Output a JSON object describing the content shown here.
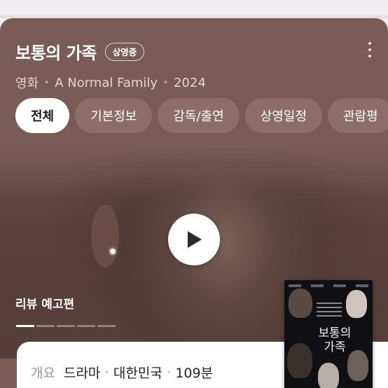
{
  "header": {
    "title": "보통의 가족",
    "status_badge": "상영중",
    "more_icon": "more-vertical-icon",
    "subtitle": {
      "category": "영화",
      "original_title": "A Normal Family",
      "year": "2024"
    }
  },
  "tabs": [
    {
      "label": "전체",
      "active": true
    },
    {
      "label": "기본정보",
      "active": false
    },
    {
      "label": "감독/출연",
      "active": false
    },
    {
      "label": "상영일정",
      "active": false
    },
    {
      "label": "관람평",
      "active": false
    }
  ],
  "video": {
    "label": "리뷰 예고편",
    "play_icon": "play-icon",
    "slides_total": 5,
    "slide_active": 1
  },
  "overview": {
    "label": "개요",
    "genre": "드라마",
    "country": "대한민국",
    "runtime": "109분"
  },
  "poster": {
    "title": "보통의 가족"
  },
  "colors": {
    "hero_background": "#7a5c57",
    "tab_inactive": "#8c6d68",
    "tab_active": "#ffffff"
  }
}
